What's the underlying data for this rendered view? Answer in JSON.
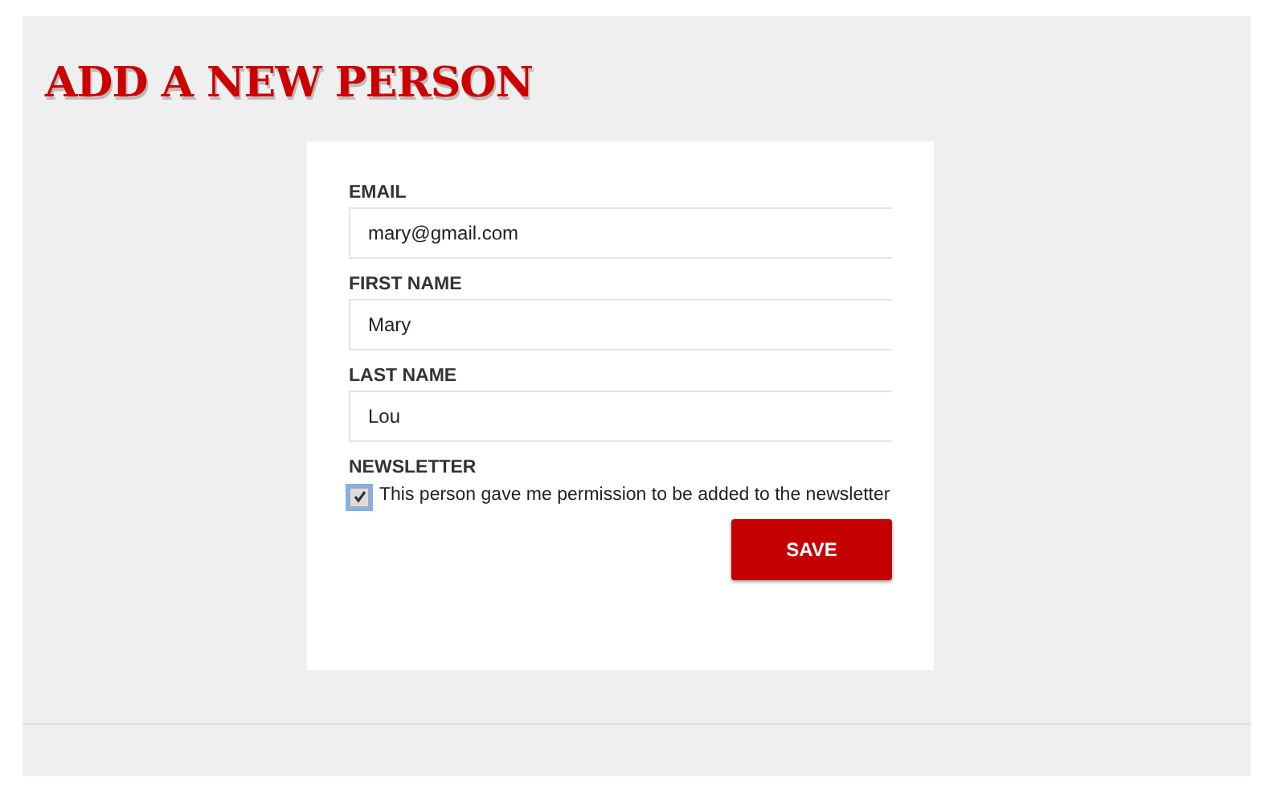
{
  "title": "ADD A NEW PERSON",
  "fields": [
    {
      "label": "EMAIL",
      "value": "mary@gmail.com"
    },
    {
      "label": "FIRST NAME",
      "value": "Mary"
    },
    {
      "label": "LAST NAME",
      "value": "Lou"
    }
  ],
  "newsletter": {
    "label": "NEWSLETTER",
    "checkbox_text": "This person gave me permission to be added to the newsletter",
    "checked": true
  },
  "buttons": [
    "SAVE"
  ]
}
